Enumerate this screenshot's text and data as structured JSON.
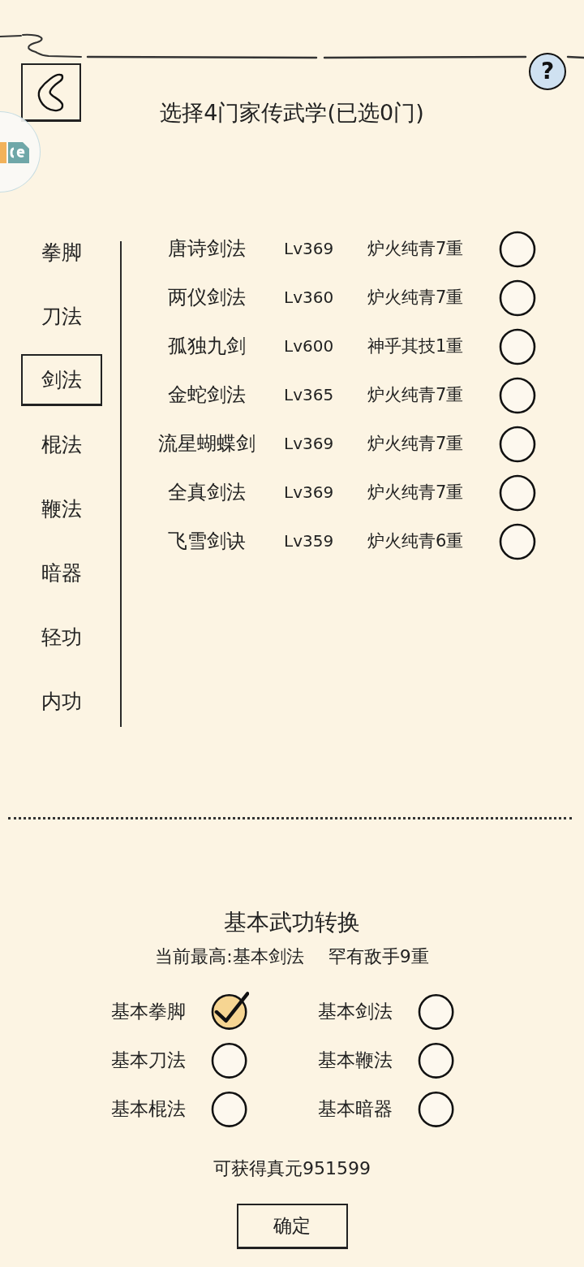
{
  "header": {
    "title": "选择4门家传武学(已选0门)",
    "help": "?"
  },
  "categories": [
    {
      "label": "拳脚",
      "selected": false
    },
    {
      "label": "刀法",
      "selected": false
    },
    {
      "label": "剑法",
      "selected": true
    },
    {
      "label": "棍法",
      "selected": false
    },
    {
      "label": "鞭法",
      "selected": false
    },
    {
      "label": "暗器",
      "selected": false
    },
    {
      "label": "轻功",
      "selected": false
    },
    {
      "label": "内功",
      "selected": false
    }
  ],
  "skills": [
    {
      "name": "唐诗剑法",
      "level": "Lv369",
      "realm": "炉火纯青7重",
      "selected": false
    },
    {
      "name": "两仪剑法",
      "level": "Lv360",
      "realm": "炉火纯青7重",
      "selected": false
    },
    {
      "name": "孤独九剑",
      "level": "Lv600",
      "realm": "神乎其技1重",
      "selected": false
    },
    {
      "name": "金蛇剑法",
      "level": "Lv365",
      "realm": "炉火纯青7重",
      "selected": false
    },
    {
      "name": "流星蝴蝶剑",
      "level": "Lv369",
      "realm": "炉火纯青7重",
      "selected": false
    },
    {
      "name": "全真剑法",
      "level": "Lv369",
      "realm": "炉火纯青7重",
      "selected": false
    },
    {
      "name": "飞雪剑诀",
      "level": "Lv359",
      "realm": "炉火纯青6重",
      "selected": false
    }
  ],
  "conversion": {
    "title": "基本武功转换",
    "current": "当前最高:基本剑法",
    "rank": "罕有敌手9重",
    "options": [
      {
        "label": "基本拳脚",
        "checked": true
      },
      {
        "label": "基本剑法",
        "checked": false
      },
      {
        "label": "基本刀法",
        "checked": false
      },
      {
        "label": "基本鞭法",
        "checked": false
      },
      {
        "label": "基本棍法",
        "checked": false
      },
      {
        "label": "基本暗器",
        "checked": false
      }
    ],
    "reward": "可获得真元951599",
    "confirm": "确定"
  }
}
